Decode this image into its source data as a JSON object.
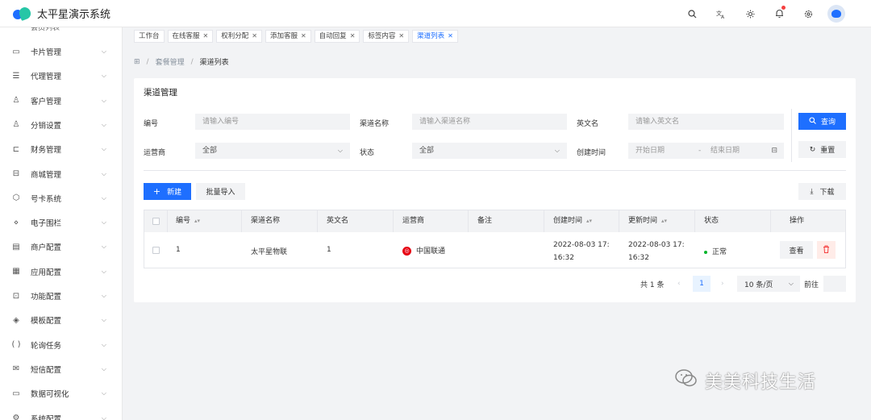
{
  "app": {
    "title": "太平星演示系统"
  },
  "sidebar": {
    "cut_label": "会员列表",
    "items": [
      {
        "icon": "▭",
        "label": "卡片管理"
      },
      {
        "icon": "☰",
        "label": "代理管理"
      },
      {
        "icon": "♙",
        "label": "客户管理"
      },
      {
        "icon": "♙",
        "label": "分销设置"
      },
      {
        "icon": "⊏",
        "label": "财务管理"
      },
      {
        "icon": "⊟",
        "label": "商城管理"
      },
      {
        "icon": "⬡",
        "label": "号卡系统"
      },
      {
        "icon": "⋄",
        "label": "电子围栏"
      },
      {
        "icon": "▤",
        "label": "商户配置"
      },
      {
        "icon": "▦",
        "label": "应用配置"
      },
      {
        "icon": "⊡",
        "label": "功能配置"
      },
      {
        "icon": "◈",
        "label": "模板配置"
      },
      {
        "icon": "( )",
        "label": "轮询任务"
      },
      {
        "icon": "✉",
        "label": "短信配置"
      },
      {
        "icon": "▭",
        "label": "数据可视化"
      },
      {
        "icon": "⚙",
        "label": "系统配置"
      }
    ]
  },
  "tabs": [
    {
      "label": "工作台",
      "closable": false,
      "active": false
    },
    {
      "label": "在线客服",
      "closable": true,
      "active": false
    },
    {
      "label": "权利分配",
      "closable": true,
      "active": false
    },
    {
      "label": "添加客服",
      "closable": true,
      "active": false
    },
    {
      "label": "自动回复",
      "closable": true,
      "active": false
    },
    {
      "label": "标签内容",
      "closable": true,
      "active": false
    },
    {
      "label": "渠道列表",
      "closable": true,
      "active": true
    }
  ],
  "breadcrumb": {
    "home_icon": "⊞",
    "parent": "套餐管理",
    "current": "渠道列表"
  },
  "panel_title": "渠道管理",
  "filters": {
    "code_label": "编号",
    "code_placeholder": "请输入编号",
    "name_label": "渠道名称",
    "name_placeholder": "请输入渠道名称",
    "en_label": "英文名",
    "en_placeholder": "请输入英文名",
    "operator_label": "运营商",
    "operator_value": "全部",
    "status_label": "状态",
    "status_value": "全部",
    "created_label": "创建时间",
    "date_start": "开始日期",
    "date_sep": "-",
    "date_end": "结束日期"
  },
  "actions": {
    "search": "查询",
    "reset": "重置",
    "create": "新建",
    "import": "批量导入",
    "download": "下载"
  },
  "table": {
    "headers": {
      "code": "编号",
      "name": "渠道名称",
      "en": "英文名",
      "operator": "运营商",
      "remark": "备注",
      "created": "创建时间",
      "updated": "更新时间",
      "status": "状态",
      "ops": "操作"
    },
    "rows": [
      {
        "code": "1",
        "name": "太平星物联",
        "en": "1",
        "operator": "中国联通",
        "remark": "",
        "created_line1": "2022-08-03 17:",
        "created_line2": "16:32",
        "updated_line1": "2022-08-03 17:",
        "updated_line2": "16:32",
        "status": "正常",
        "view": "查看"
      }
    ]
  },
  "pagination": {
    "total": "共 1 条",
    "prev": "‹",
    "page": "1",
    "next": "›",
    "page_size": "10 条/页",
    "goto": "前往"
  },
  "watermark": {
    "text": "美美科技生活"
  },
  "colors": {
    "primary": "#1e6fff",
    "danger": "#f53f3f",
    "success": "#00b42a"
  }
}
